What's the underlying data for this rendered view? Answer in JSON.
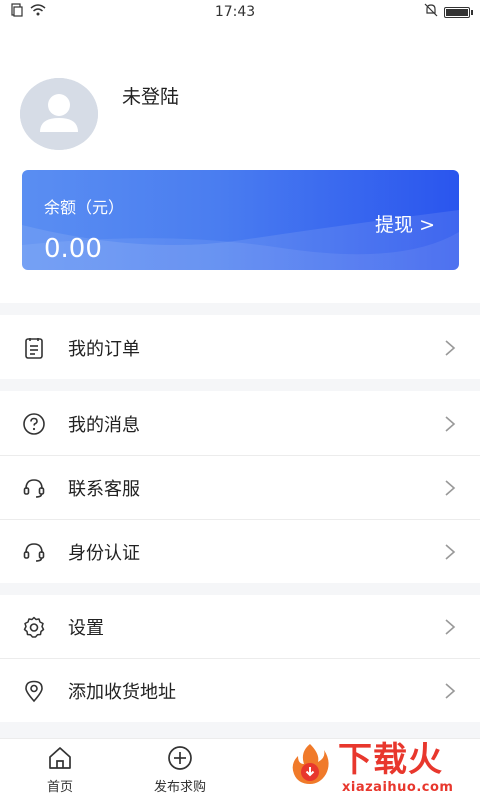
{
  "status_bar": {
    "time": "17:43",
    "battery_level": 0.9
  },
  "profile": {
    "username": "未登陆"
  },
  "balance": {
    "label": "余额（元）",
    "value": "0.00",
    "withdraw_label": "提现 >"
  },
  "menu": {
    "orders": "我的订单",
    "messages": "我的消息",
    "customer_service": "联系客服",
    "identity": "身份认证",
    "settings": "设置",
    "address": "添加收货地址"
  },
  "tabs": [
    {
      "label": "首页",
      "icon": "home-icon"
    },
    {
      "label": "发布求购",
      "icon": "add-circle-icon"
    }
  ],
  "watermark": {
    "title": "下载火",
    "url": "xiazaihuo.com"
  },
  "colors": {
    "card_start": "#5a8ef2",
    "card_end": "#2a55ee",
    "watermark": "#e8372d"
  }
}
